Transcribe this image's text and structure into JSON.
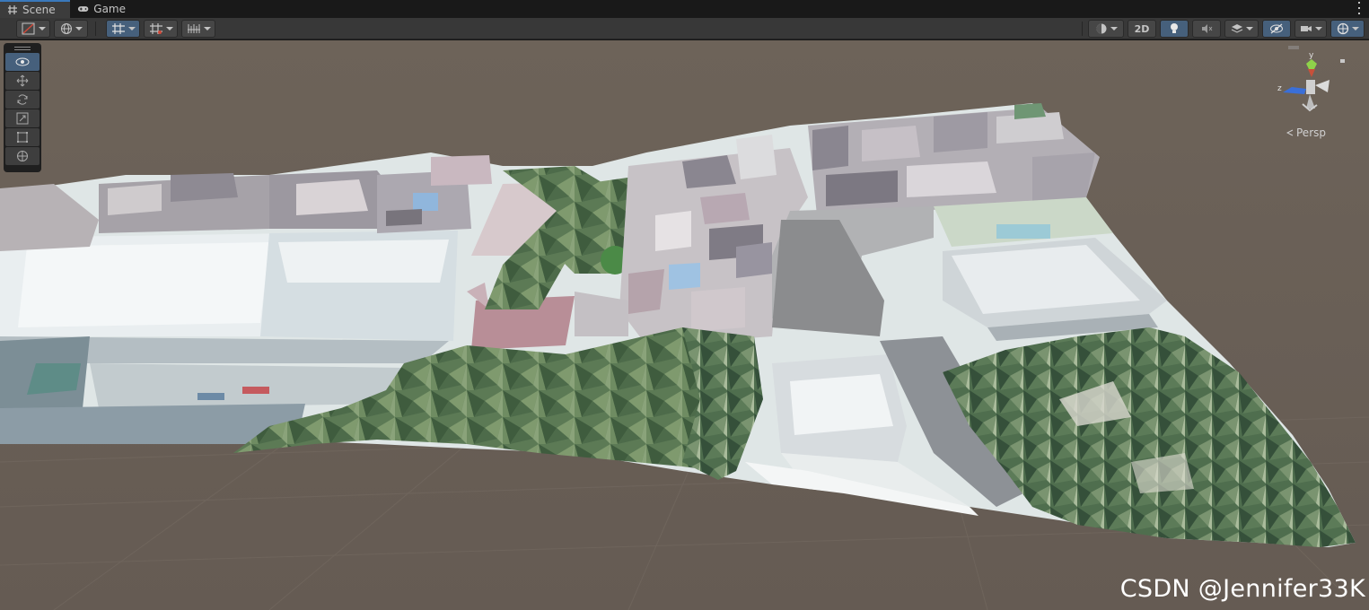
{
  "tabs": [
    {
      "label": "Scene",
      "icon": "grid-hash-icon",
      "active": true
    },
    {
      "label": "Game",
      "icon": "gamepad-icon",
      "active": false
    }
  ],
  "toolbar": {
    "draw_mode_icon": "shading-mode-icon",
    "global_icon": "globe-icon",
    "grid_snap_icon": "grid-snapping-icon",
    "grid_icon": "grid-visibility-icon",
    "increment_icon": "increment-snap-icon",
    "shading_icon": "shading-sphere-icon",
    "two_d_label": "2D",
    "lighting_icon": "lightbulb-icon",
    "audio_icon": "audio-mute-icon",
    "effects_icon": "effects-layers-icon",
    "visibility_icon": "hidden-eye-icon",
    "camera_icon": "camera-icon",
    "gizmos_icon": "gizmos-icon"
  },
  "tools": [
    {
      "name": "view-tool",
      "icon": "eye-icon",
      "active": true
    },
    {
      "name": "move-tool",
      "icon": "move-arrows-icon",
      "active": false
    },
    {
      "name": "rotate-tool",
      "icon": "rotate-icon",
      "active": false
    },
    {
      "name": "scale-tool",
      "icon": "scale-icon",
      "active": false
    },
    {
      "name": "rect-tool",
      "icon": "rect-transform-icon",
      "active": false
    },
    {
      "name": "transform-tool",
      "icon": "transform-icon",
      "active": false
    }
  ],
  "gizmo": {
    "y_label": "y",
    "z_label": "z",
    "projection_label": "Persp"
  },
  "watermark": "CSDN @Jennifer33K",
  "colors": {
    "background_ground": "#6a6159",
    "accent_blue": "#46607c",
    "tab_active_top": "#3a79bb",
    "gizmo_y": "#8ed24a",
    "gizmo_z": "#3a6fd8",
    "gizmo_x_hidden": "#c8503a"
  }
}
